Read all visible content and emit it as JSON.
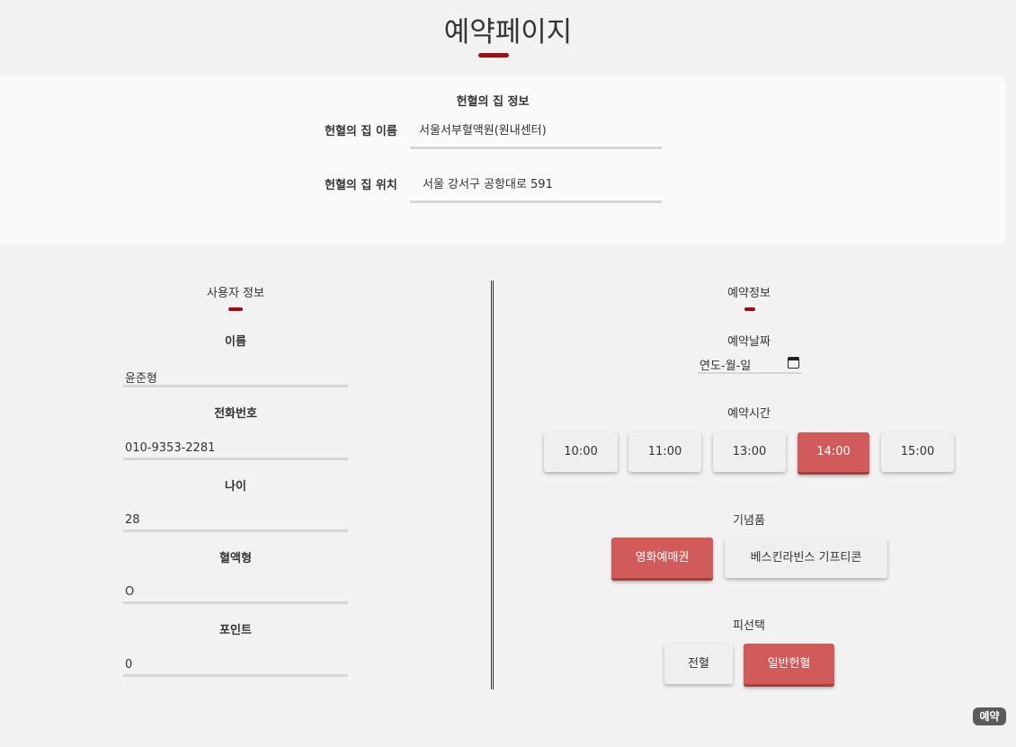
{
  "page": {
    "title": "예약페이지"
  },
  "center_info": {
    "title": "헌혈의 집 정보",
    "name_label": "헌혈의 집 이름",
    "name_value": "서울서부혈액원(원내센터)",
    "location_label": "헌혈의 집 위치",
    "location_value": "서울 강서구 공항대로 591"
  },
  "user_info": {
    "title": "사용자 정보",
    "fields": [
      {
        "label": "이름",
        "value": "윤준형"
      },
      {
        "label": "전화번호",
        "value": "010-9353-2281"
      },
      {
        "label": "나이",
        "value": "28"
      },
      {
        "label": "혈액형",
        "value": "O"
      },
      {
        "label": "포인트",
        "value": "0"
      }
    ]
  },
  "reservation": {
    "title": "예약정보",
    "date_label": "예약날짜",
    "date_placeholder": "연도-월-일",
    "time_label": "예약시간",
    "times": [
      {
        "label": "10:00",
        "selected": false
      },
      {
        "label": "11:00",
        "selected": false
      },
      {
        "label": "13:00",
        "selected": false
      },
      {
        "label": "14:00",
        "selected": true
      },
      {
        "label": "15:00",
        "selected": false
      }
    ],
    "gift_label": "기념품",
    "gifts": [
      {
        "label": "영화예매권",
        "selected": true
      },
      {
        "label": "베스킨라빈스 기프티콘",
        "selected": false
      }
    ],
    "blood_choice_label": "피선택",
    "blood_choices": [
      {
        "label": "전혈",
        "selected": false
      },
      {
        "label": "일반헌혈",
        "selected": true
      }
    ]
  },
  "floating_button": {
    "label": "예약"
  },
  "colors": {
    "accent_bar": "#a30d12",
    "selected_button": "#d15b5b",
    "unselected_button": "#efefef",
    "background": "#f2f2f2"
  },
  "icons": {
    "date_picker": "calendar-icon"
  }
}
